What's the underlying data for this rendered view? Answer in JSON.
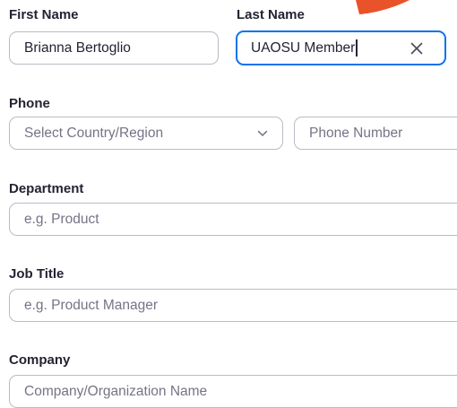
{
  "colors": {
    "focus_border": "#0e72ed",
    "accent_orange": "#e8532a"
  },
  "first_name": {
    "label": "First Name",
    "value": "Brianna Bertoglio"
  },
  "last_name": {
    "label": "Last Name",
    "value": "UAOSU Member"
  },
  "phone": {
    "label": "Phone",
    "country_placeholder": "Select Country/Region",
    "number_placeholder": "Phone Number"
  },
  "department": {
    "label": "Department",
    "placeholder": "e.g. Product"
  },
  "job_title": {
    "label": "Job Title",
    "placeholder": "e.g. Product Manager"
  },
  "company": {
    "label": "Company",
    "placeholder": "Company/Organization Name"
  },
  "icons": {
    "clear": "close-icon",
    "dropdown": "chevron-down-icon"
  }
}
